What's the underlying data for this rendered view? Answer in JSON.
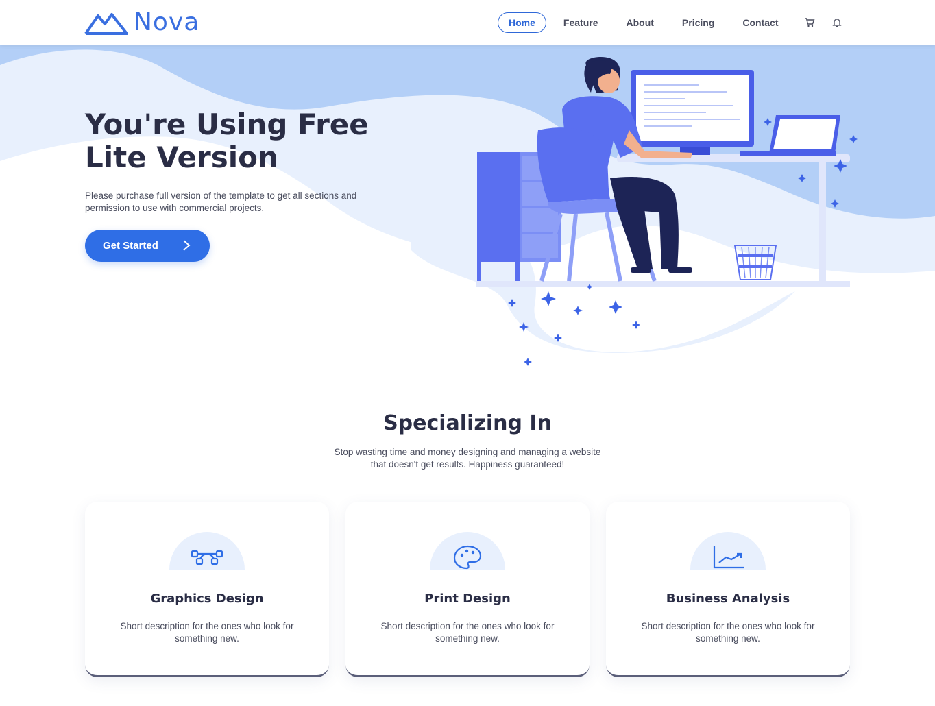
{
  "brand": {
    "name": "Nova",
    "logo_icon": "mountain-logo-icon",
    "color": "#3a6fe0"
  },
  "nav": {
    "items": [
      {
        "label": "Home",
        "active": true
      },
      {
        "label": "Feature",
        "active": false
      },
      {
        "label": "About",
        "active": false
      },
      {
        "label": "Pricing",
        "active": false
      },
      {
        "label": "Contact",
        "active": false
      }
    ],
    "icons": [
      "cart-icon",
      "bell-icon"
    ]
  },
  "hero": {
    "title_line1": "You're Using Free",
    "title_line2": "Lite Version",
    "subtitle": "Please purchase full version of the template to get all sections and permission to use with commercial projects.",
    "cta_label": "Get Started",
    "cta_icon": "chevron-right-icon"
  },
  "services": {
    "title": "Specializing In",
    "subtitle": "Stop wasting time and money designing and managing a website that doesn't get results. Happiness guaranteed!",
    "cards": [
      {
        "title": "Graphics Design",
        "description": "Short description for the ones who look for something new.",
        "icon": "vector-nodes-icon"
      },
      {
        "title": "Print Design",
        "description": "Short description for the ones who look for something new.",
        "icon": "palette-icon"
      },
      {
        "title": "Business Analysis",
        "description": "Short description for the ones who look for something new.",
        "icon": "growth-chart-icon"
      }
    ]
  },
  "colors": {
    "accent": "#2f6ee6",
    "hero_light": "#e8f0fd",
    "hero_mid": "#b3cff7",
    "heading": "#2a2d45"
  }
}
